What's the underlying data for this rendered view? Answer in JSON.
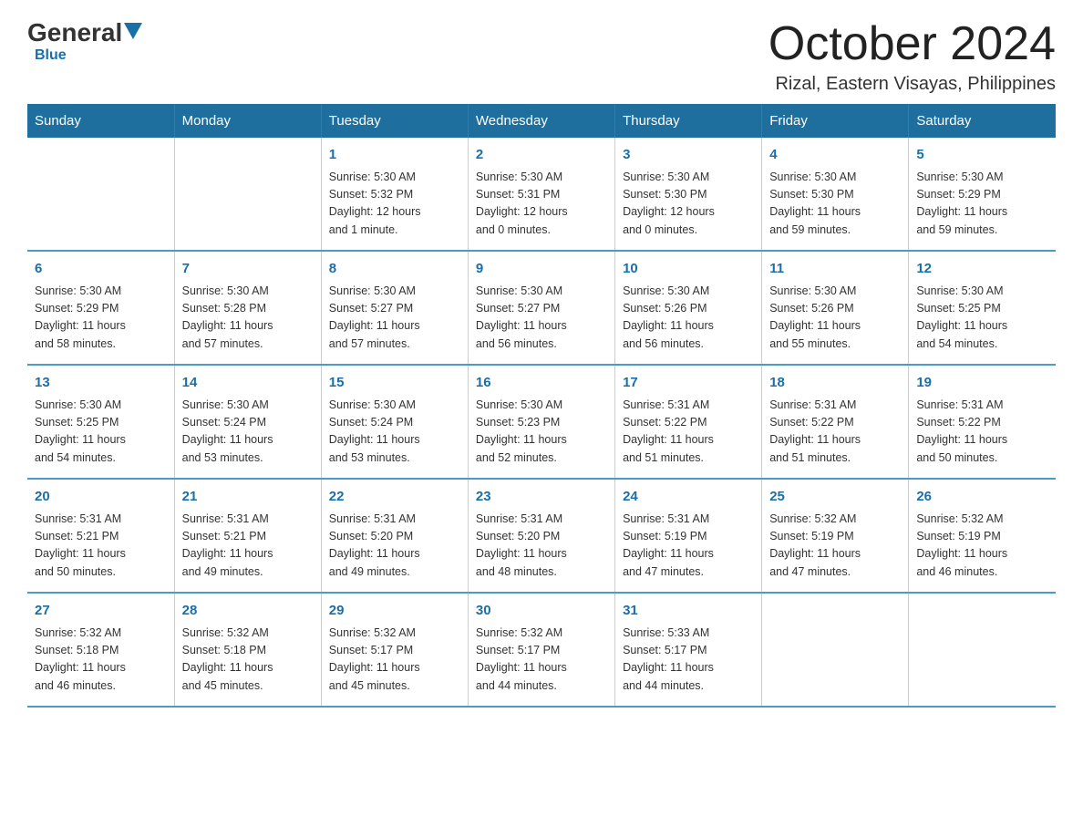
{
  "logo": {
    "general": "General",
    "triangle": "",
    "blue_label": "Blue"
  },
  "title": "October 2024",
  "subtitle": "Rizal, Eastern Visayas, Philippines",
  "days_header": [
    "Sunday",
    "Monday",
    "Tuesday",
    "Wednesday",
    "Thursday",
    "Friday",
    "Saturday"
  ],
  "weeks": [
    [
      {
        "day": "",
        "info": ""
      },
      {
        "day": "",
        "info": ""
      },
      {
        "day": "1",
        "info": "Sunrise: 5:30 AM\nSunset: 5:32 PM\nDaylight: 12 hours\nand 1 minute."
      },
      {
        "day": "2",
        "info": "Sunrise: 5:30 AM\nSunset: 5:31 PM\nDaylight: 12 hours\nand 0 minutes."
      },
      {
        "day": "3",
        "info": "Sunrise: 5:30 AM\nSunset: 5:30 PM\nDaylight: 12 hours\nand 0 minutes."
      },
      {
        "day": "4",
        "info": "Sunrise: 5:30 AM\nSunset: 5:30 PM\nDaylight: 11 hours\nand 59 minutes."
      },
      {
        "day": "5",
        "info": "Sunrise: 5:30 AM\nSunset: 5:29 PM\nDaylight: 11 hours\nand 59 minutes."
      }
    ],
    [
      {
        "day": "6",
        "info": "Sunrise: 5:30 AM\nSunset: 5:29 PM\nDaylight: 11 hours\nand 58 minutes."
      },
      {
        "day": "7",
        "info": "Sunrise: 5:30 AM\nSunset: 5:28 PM\nDaylight: 11 hours\nand 57 minutes."
      },
      {
        "day": "8",
        "info": "Sunrise: 5:30 AM\nSunset: 5:27 PM\nDaylight: 11 hours\nand 57 minutes."
      },
      {
        "day": "9",
        "info": "Sunrise: 5:30 AM\nSunset: 5:27 PM\nDaylight: 11 hours\nand 56 minutes."
      },
      {
        "day": "10",
        "info": "Sunrise: 5:30 AM\nSunset: 5:26 PM\nDaylight: 11 hours\nand 56 minutes."
      },
      {
        "day": "11",
        "info": "Sunrise: 5:30 AM\nSunset: 5:26 PM\nDaylight: 11 hours\nand 55 minutes."
      },
      {
        "day": "12",
        "info": "Sunrise: 5:30 AM\nSunset: 5:25 PM\nDaylight: 11 hours\nand 54 minutes."
      }
    ],
    [
      {
        "day": "13",
        "info": "Sunrise: 5:30 AM\nSunset: 5:25 PM\nDaylight: 11 hours\nand 54 minutes."
      },
      {
        "day": "14",
        "info": "Sunrise: 5:30 AM\nSunset: 5:24 PM\nDaylight: 11 hours\nand 53 minutes."
      },
      {
        "day": "15",
        "info": "Sunrise: 5:30 AM\nSunset: 5:24 PM\nDaylight: 11 hours\nand 53 minutes."
      },
      {
        "day": "16",
        "info": "Sunrise: 5:30 AM\nSunset: 5:23 PM\nDaylight: 11 hours\nand 52 minutes."
      },
      {
        "day": "17",
        "info": "Sunrise: 5:31 AM\nSunset: 5:22 PM\nDaylight: 11 hours\nand 51 minutes."
      },
      {
        "day": "18",
        "info": "Sunrise: 5:31 AM\nSunset: 5:22 PM\nDaylight: 11 hours\nand 51 minutes."
      },
      {
        "day": "19",
        "info": "Sunrise: 5:31 AM\nSunset: 5:22 PM\nDaylight: 11 hours\nand 50 minutes."
      }
    ],
    [
      {
        "day": "20",
        "info": "Sunrise: 5:31 AM\nSunset: 5:21 PM\nDaylight: 11 hours\nand 50 minutes."
      },
      {
        "day": "21",
        "info": "Sunrise: 5:31 AM\nSunset: 5:21 PM\nDaylight: 11 hours\nand 49 minutes."
      },
      {
        "day": "22",
        "info": "Sunrise: 5:31 AM\nSunset: 5:20 PM\nDaylight: 11 hours\nand 49 minutes."
      },
      {
        "day": "23",
        "info": "Sunrise: 5:31 AM\nSunset: 5:20 PM\nDaylight: 11 hours\nand 48 minutes."
      },
      {
        "day": "24",
        "info": "Sunrise: 5:31 AM\nSunset: 5:19 PM\nDaylight: 11 hours\nand 47 minutes."
      },
      {
        "day": "25",
        "info": "Sunrise: 5:32 AM\nSunset: 5:19 PM\nDaylight: 11 hours\nand 47 minutes."
      },
      {
        "day": "26",
        "info": "Sunrise: 5:32 AM\nSunset: 5:19 PM\nDaylight: 11 hours\nand 46 minutes."
      }
    ],
    [
      {
        "day": "27",
        "info": "Sunrise: 5:32 AM\nSunset: 5:18 PM\nDaylight: 11 hours\nand 46 minutes."
      },
      {
        "day": "28",
        "info": "Sunrise: 5:32 AM\nSunset: 5:18 PM\nDaylight: 11 hours\nand 45 minutes."
      },
      {
        "day": "29",
        "info": "Sunrise: 5:32 AM\nSunset: 5:17 PM\nDaylight: 11 hours\nand 45 minutes."
      },
      {
        "day": "30",
        "info": "Sunrise: 5:32 AM\nSunset: 5:17 PM\nDaylight: 11 hours\nand 44 minutes."
      },
      {
        "day": "31",
        "info": "Sunrise: 5:33 AM\nSunset: 5:17 PM\nDaylight: 11 hours\nand 44 minutes."
      },
      {
        "day": "",
        "info": ""
      },
      {
        "day": "",
        "info": ""
      }
    ]
  ]
}
